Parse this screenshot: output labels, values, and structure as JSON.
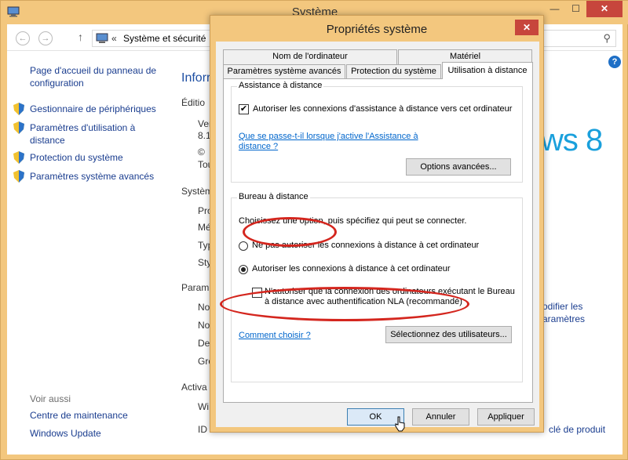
{
  "background_window": {
    "title": "Système",
    "controls": {
      "minimize": "—",
      "maximize": "☐",
      "close": "✕"
    },
    "address": {
      "chevron": "«",
      "path": "Système et sécurité"
    },
    "sidebar": {
      "home": "Page d'accueil du panneau de configuration",
      "links": [
        {
          "label": "Gestionnaire de périphériques",
          "icon": "shield-icon"
        },
        {
          "label": "Paramètres d'utilisation à distance",
          "icon": "shield-icon"
        },
        {
          "label": "Protection du système",
          "icon": "shield-icon"
        },
        {
          "label": "Paramètres système avancés",
          "icon": "shield-icon"
        }
      ],
      "see_also": "Voir aussi",
      "see_also_links": [
        "Centre de maintenance",
        "Windows Update"
      ]
    },
    "main": {
      "heading": "Inforr",
      "fragments": [
        "Éditio",
        "Ver",
        "8.1",
        "©",
        "Tou",
        "Systèm",
        "Pro",
        "Mé",
        "Typ",
        "Sty",
        "Param",
        "No",
        "No",
        "Des",
        "Gro",
        "Activa",
        "Wi",
        "ID"
      ],
      "logo": "ws 8",
      "right_links": [
        "odifier les",
        "aramètres",
        "clé de produit"
      ]
    }
  },
  "dialog": {
    "title": "Propriétés système",
    "close": "✕",
    "tabs": {
      "computer_name": "Nom de l'ordinateur",
      "hardware": "Matériel",
      "advanced": "Paramètres système avancés",
      "protection": "Protection du système",
      "remote": "Utilisation à distance"
    },
    "assistance": {
      "title": "Assistance à distance",
      "checkbox_label": "Autoriser les connexions d'assistance à distance vers cet ordinateur",
      "checked": true,
      "help_link": "Que se passe-t-il lorsque j'active l'Assistance à distance ?",
      "advanced_button": "Options avancées..."
    },
    "remote_desktop": {
      "title": "Bureau à distance",
      "description": "Choisissez une option, puis spécifiez qui peut se connecter.",
      "option_deny": "Ne pas autoriser les connexions à distance à cet ordinateur",
      "option_allow": "Autoriser les connexions à distance à cet ordinateur",
      "selected": "allow",
      "nla_label": "N'autoriser que la connexion des ordinateurs exécutant le Bureau à distance avec authentification NLA (recommandé)",
      "nla_checked": false,
      "choose_link": "Comment choisir ?",
      "users_button": "Sélectionnez des utilisateurs..."
    },
    "buttons": {
      "ok": "OK",
      "cancel": "Annuler",
      "apply": "Appliquer"
    }
  },
  "colors": {
    "accent": "#f3c77e",
    "link": "#0066cc",
    "highlight_oval": "#d4261e",
    "close": "#c7463c"
  }
}
